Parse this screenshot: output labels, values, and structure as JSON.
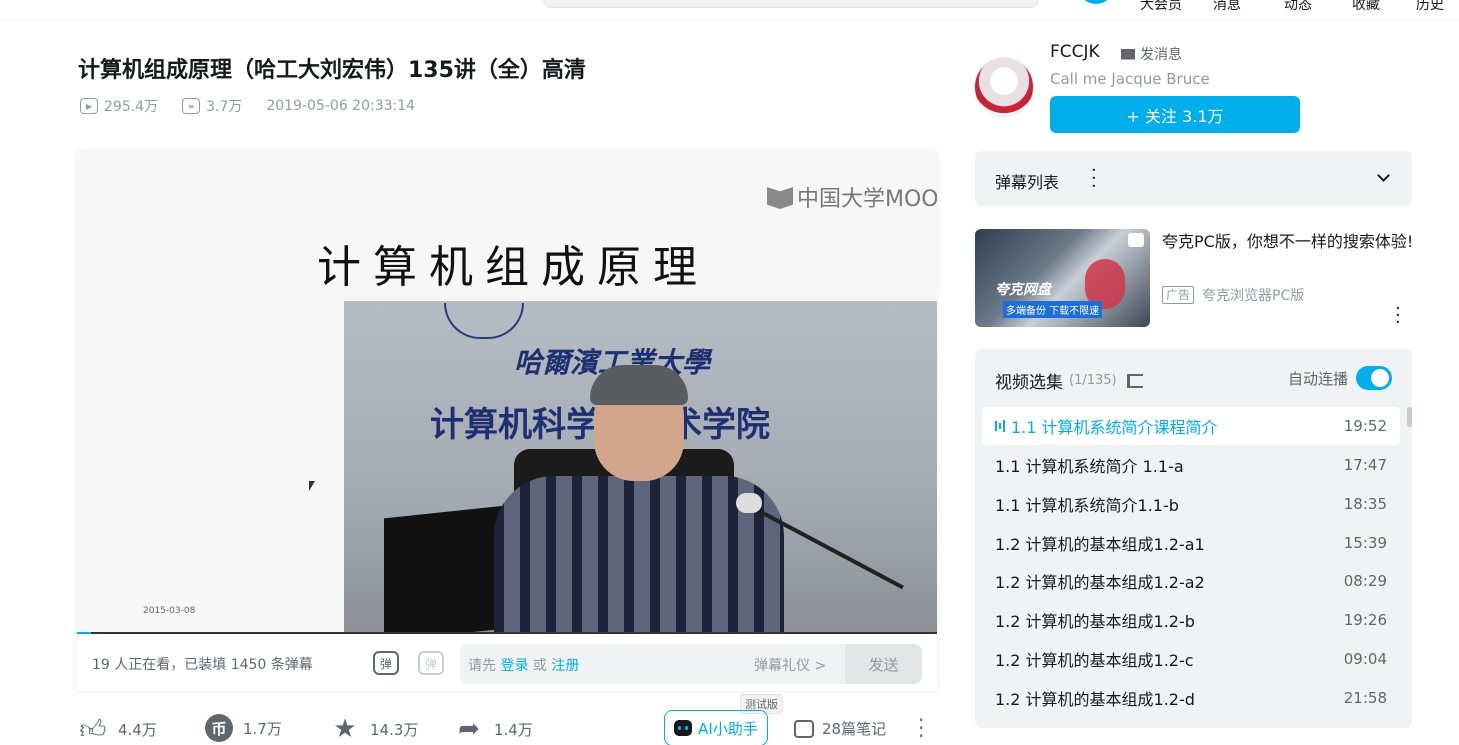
{
  "header": {
    "nav": [
      "大会员",
      "消息",
      "动态",
      "收藏",
      "历史"
    ]
  },
  "video": {
    "title": "计算机组成原理（哈工大刘宏伟）135讲（全）高清",
    "views": "295.4万",
    "danmaku_count": "3.7万",
    "publish_time": "2019-05-06 20:33:14",
    "frame": {
      "slide_title": "计算机组成原理",
      "mooc_logo": "中国大学MOOC",
      "date_stamp": "2015-03-08",
      "school_name": "哈爾濱工業大學",
      "dept_name": "计算机科学与技术学院"
    },
    "progress": 0.016
  },
  "danmaku_bar": {
    "viewers": "19 人正在看，已装填 1450 条弹幕",
    "toggle_on_icon": "弹",
    "toggle_settings_icon": "弹",
    "input_hint_prefix": "请先 ",
    "login_link": "登录",
    "hint_or": " 或 ",
    "register_link": "注册",
    "etiquette": "弹幕礼仪 >",
    "send": "发送"
  },
  "toolbar": {
    "like": "4.4万",
    "coin": "1.7万",
    "coin_glyph": "币",
    "favorite": "14.3万",
    "share": "1.4万",
    "ai_label": "AI小助手",
    "beta_tag": "测试版",
    "notes": "28篇笔记"
  },
  "uploader": {
    "name": "FCCJK",
    "message": "发消息",
    "signature": "Call me Jacque Bruce",
    "follow": "+ 关注 3.1万"
  },
  "danmaku_list": {
    "label": "弹幕列表"
  },
  "ad": {
    "headline": "夸克PC版，你想不一样的搜索体验!",
    "tag": "广告",
    "source": "夸克浏览器PC版",
    "thumb_brand": "夸克网盘",
    "thumb_slogan": "多端备份 下载不限速"
  },
  "playlist": {
    "title": "视频选集",
    "count": "(1/135)",
    "autoplay_label": "自动连播",
    "autoplay_on": true,
    "episodes": [
      {
        "name": "1.1 计算机系统简介课程简介",
        "duration": "19:52"
      },
      {
        "name": "1.1 计算机系统简介 1.1-a",
        "duration": "17:47"
      },
      {
        "name": "1.1 计算机系统简介1.1-b",
        "duration": "18:35"
      },
      {
        "name": "1.2 计算机的基本组成1.2-a1",
        "duration": "15:39"
      },
      {
        "name": "1.2 计算机的基本组成1.2-a2",
        "duration": "08:29"
      },
      {
        "name": "1.2 计算机的基本组成1.2-b",
        "duration": "19:26"
      },
      {
        "name": "1.2 计算机的基本组成1.2-c",
        "duration": "09:04"
      },
      {
        "name": "1.2 计算机的基本组成1.2-d",
        "duration": "21:58"
      }
    ]
  },
  "colors": {
    "accent": "#00aeec",
    "text": "#18191c",
    "muted": "#9499a0",
    "panel": "#f1f2f3"
  }
}
